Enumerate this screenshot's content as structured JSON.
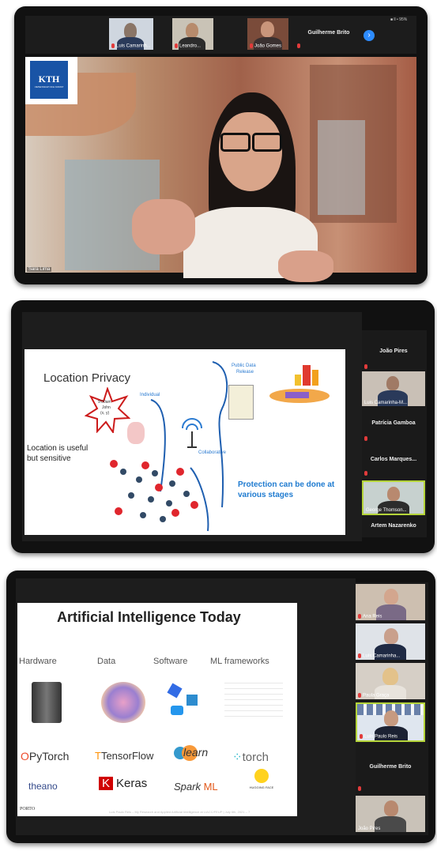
{
  "panel1": {
    "gallery": [
      {
        "name": "Luis Camarinh..."
      },
      {
        "name": "Leandro..."
      },
      {
        "name": "João Gomes"
      },
      {
        "name": "Guilherme Brito"
      }
    ],
    "status": "■ ll • 95%",
    "main_speaker": "Sara Lima",
    "logo_text": "KTH",
    "logo_sub": "VETENSKAP OCH KONST"
  },
  "panel2": {
    "slide": {
      "title": "Location Privacy",
      "star_time": "9:00am",
      "star_name": "John",
      "star_coords": "(x, y)",
      "label_individual": "Individual",
      "label_collaborative": "Collaborative",
      "label_public": "Public Data",
      "label_public2": "Release",
      "text_useful": "Location is useful",
      "text_sensitive": "but sensitive",
      "protection_1": "Protection can be done at",
      "protection_2": "various stages"
    },
    "participants": [
      {
        "name": "João Pires",
        "video": false
      },
      {
        "name": "Luis Camarinha-M...",
        "video": true
      },
      {
        "name": "Patrícia Gamboa",
        "video": false
      },
      {
        "name": "Carlos Marques...",
        "video": false
      },
      {
        "name": "George Thomson...",
        "video": true
      },
      {
        "name": "Artem Nazarenko",
        "video": false
      }
    ]
  },
  "panel3": {
    "slide": {
      "title": "Artificial Intelligence Today",
      "categories": [
        "Hardware",
        "Data",
        "Software",
        "ML frameworks"
      ],
      "frameworks": {
        "pytorch": "PyTorch",
        "tensorflow": "TensorFlow",
        "sklearn": "learn",
        "torch": "torch",
        "theano": "theano",
        "keras": "Keras",
        "spark": "Spark",
        "spark_ml": "ML",
        "hugging": "HUGGING FACE"
      },
      "footer_logo": "PORTO",
      "footer_text": "Luís Paulo Reis – My Research and Applied Artificial Intelligence at LIACC/FEUP | July 6th, 2021 – 7"
    },
    "participants": [
      {
        "name": "Ana Reis",
        "video": true
      },
      {
        "name": "Luís Camarinha...",
        "video": true
      },
      {
        "name": "Paula Graça",
        "video": true
      },
      {
        "name": "Luís Paulo Reis",
        "video": true,
        "active": true
      },
      {
        "name": "Guilherme Brito",
        "video": false
      },
      {
        "name": "João Pires",
        "video": true
      }
    ]
  }
}
